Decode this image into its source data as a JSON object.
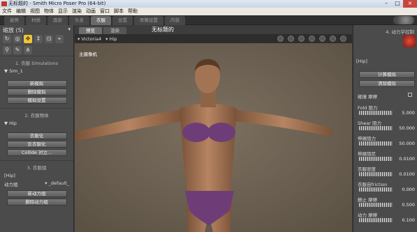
{
  "titlebar": {
    "title": "无标题的 - Smith Micro Poser Pro  (64-bit)"
  },
  "menubar": [
    "文件",
    "编辑",
    "视图",
    "物体",
    "显示",
    "渲染",
    "动画",
    "窗口",
    "脚本",
    "帮助"
  ],
  "room_tabs": [
    {
      "label": "姿势",
      "active": false
    },
    {
      "label": "材质",
      "active": false
    },
    {
      "label": "面部",
      "active": false
    },
    {
      "label": "头发",
      "active": false
    },
    {
      "label": "衣服",
      "active": true
    },
    {
      "label": "设置",
      "active": false
    },
    {
      "label": "骨骼设置",
      "active": false
    },
    {
      "label": "内容",
      "active": false
    }
  ],
  "left": {
    "header": "缩放 (S)",
    "tool_icons": [
      "rotate-icon",
      "twist-icon",
      "translate-icon",
      "translate-in-out-icon",
      "scale-icon",
      "taper-icon",
      "chain-break-icon",
      "color-icon",
      "direct-manipulation-icon"
    ],
    "sections": {
      "s1_title": "1. 衣服 Simulations",
      "s1_item": "Sim_1",
      "s1_buttons": [
        "新模拟",
        "删除模拟",
        "模拟设置"
      ],
      "s2_title": "2. 衣服物体",
      "s2_item": "Hip",
      "s2_buttons": [
        "衣服化",
        "反衣服化",
        "Collide 对立..."
      ],
      "s3_title": "3. 衣服组",
      "s3_item": "[Hip]",
      "s3_row_label": "动力组",
      "s3_row_value": "_default_",
      "s3_buttons": [
        "新动力组",
        "删除动力组"
      ]
    }
  },
  "viewport": {
    "tabs": [
      {
        "label": "预览",
        "active": true
      },
      {
        "label": "渲染",
        "active": false
      }
    ],
    "doc_title": "无标题的",
    "figure_select": "Victoria4",
    "actor_select": "Hip",
    "camera_label": "主摄像机"
  },
  "right": {
    "header": "4. 动力学控制",
    "hip_label": "[Hip]",
    "buttons": [
      "计算模拟",
      "清除模拟"
    ],
    "checkbox_label": "碰撞 摩擦",
    "params": [
      {
        "name": "Fold 阻力",
        "value": "5.000"
      },
      {
        "name": "Shear 阻力",
        "value": "50.000"
      },
      {
        "name": "伸展阻力",
        "value": "50.000"
      },
      {
        "name": "伸展阻尼",
        "value": "0.0100"
      },
      {
        "name": "衣服密度",
        "value": "0.0100"
      },
      {
        "name": "衣服自friction",
        "value": "0.000"
      },
      {
        "name": "静止 摩擦",
        "value": "0.500"
      },
      {
        "name": "动力 摩擦",
        "value": "0.100"
      }
    ]
  }
}
